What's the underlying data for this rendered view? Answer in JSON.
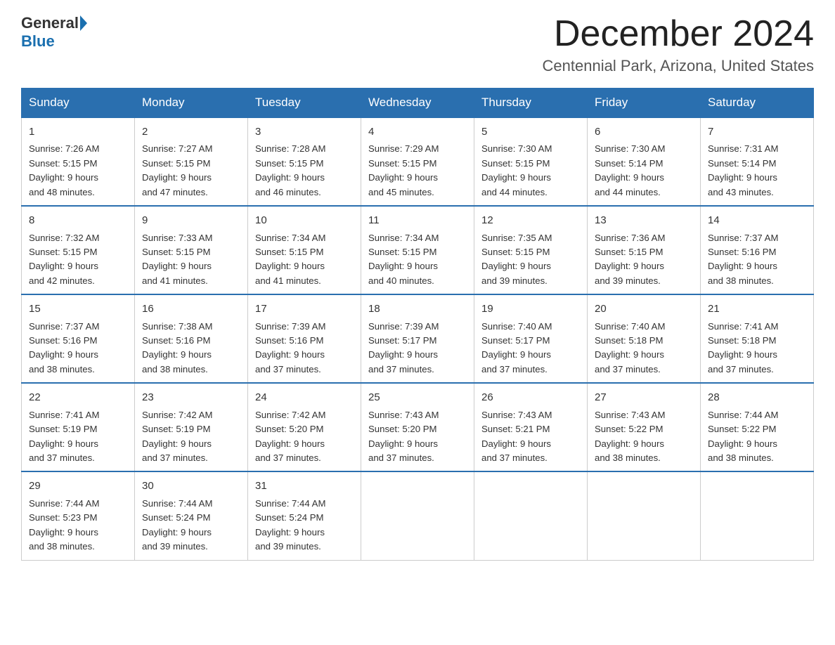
{
  "header": {
    "logo_general": "General",
    "logo_blue": "Blue",
    "month_title": "December 2024",
    "location": "Centennial Park, Arizona, United States"
  },
  "days_of_week": [
    "Sunday",
    "Monday",
    "Tuesday",
    "Wednesday",
    "Thursday",
    "Friday",
    "Saturday"
  ],
  "weeks": [
    [
      {
        "day": "1",
        "sunrise": "7:26 AM",
        "sunset": "5:15 PM",
        "daylight": "9 hours and 48 minutes."
      },
      {
        "day": "2",
        "sunrise": "7:27 AM",
        "sunset": "5:15 PM",
        "daylight": "9 hours and 47 minutes."
      },
      {
        "day": "3",
        "sunrise": "7:28 AM",
        "sunset": "5:15 PM",
        "daylight": "9 hours and 46 minutes."
      },
      {
        "day": "4",
        "sunrise": "7:29 AM",
        "sunset": "5:15 PM",
        "daylight": "9 hours and 45 minutes."
      },
      {
        "day": "5",
        "sunrise": "7:30 AM",
        "sunset": "5:15 PM",
        "daylight": "9 hours and 44 minutes."
      },
      {
        "day": "6",
        "sunrise": "7:30 AM",
        "sunset": "5:14 PM",
        "daylight": "9 hours and 44 minutes."
      },
      {
        "day": "7",
        "sunrise": "7:31 AM",
        "sunset": "5:14 PM",
        "daylight": "9 hours and 43 minutes."
      }
    ],
    [
      {
        "day": "8",
        "sunrise": "7:32 AM",
        "sunset": "5:15 PM",
        "daylight": "9 hours and 42 minutes."
      },
      {
        "day": "9",
        "sunrise": "7:33 AM",
        "sunset": "5:15 PM",
        "daylight": "9 hours and 41 minutes."
      },
      {
        "day": "10",
        "sunrise": "7:34 AM",
        "sunset": "5:15 PM",
        "daylight": "9 hours and 41 minutes."
      },
      {
        "day": "11",
        "sunrise": "7:34 AM",
        "sunset": "5:15 PM",
        "daylight": "9 hours and 40 minutes."
      },
      {
        "day": "12",
        "sunrise": "7:35 AM",
        "sunset": "5:15 PM",
        "daylight": "9 hours and 39 minutes."
      },
      {
        "day": "13",
        "sunrise": "7:36 AM",
        "sunset": "5:15 PM",
        "daylight": "9 hours and 39 minutes."
      },
      {
        "day": "14",
        "sunrise": "7:37 AM",
        "sunset": "5:16 PM",
        "daylight": "9 hours and 38 minutes."
      }
    ],
    [
      {
        "day": "15",
        "sunrise": "7:37 AM",
        "sunset": "5:16 PM",
        "daylight": "9 hours and 38 minutes."
      },
      {
        "day": "16",
        "sunrise": "7:38 AM",
        "sunset": "5:16 PM",
        "daylight": "9 hours and 38 minutes."
      },
      {
        "day": "17",
        "sunrise": "7:39 AM",
        "sunset": "5:16 PM",
        "daylight": "9 hours and 37 minutes."
      },
      {
        "day": "18",
        "sunrise": "7:39 AM",
        "sunset": "5:17 PM",
        "daylight": "9 hours and 37 minutes."
      },
      {
        "day": "19",
        "sunrise": "7:40 AM",
        "sunset": "5:17 PM",
        "daylight": "9 hours and 37 minutes."
      },
      {
        "day": "20",
        "sunrise": "7:40 AM",
        "sunset": "5:18 PM",
        "daylight": "9 hours and 37 minutes."
      },
      {
        "day": "21",
        "sunrise": "7:41 AM",
        "sunset": "5:18 PM",
        "daylight": "9 hours and 37 minutes."
      }
    ],
    [
      {
        "day": "22",
        "sunrise": "7:41 AM",
        "sunset": "5:19 PM",
        "daylight": "9 hours and 37 minutes."
      },
      {
        "day": "23",
        "sunrise": "7:42 AM",
        "sunset": "5:19 PM",
        "daylight": "9 hours and 37 minutes."
      },
      {
        "day": "24",
        "sunrise": "7:42 AM",
        "sunset": "5:20 PM",
        "daylight": "9 hours and 37 minutes."
      },
      {
        "day": "25",
        "sunrise": "7:43 AM",
        "sunset": "5:20 PM",
        "daylight": "9 hours and 37 minutes."
      },
      {
        "day": "26",
        "sunrise": "7:43 AM",
        "sunset": "5:21 PM",
        "daylight": "9 hours and 37 minutes."
      },
      {
        "day": "27",
        "sunrise": "7:43 AM",
        "sunset": "5:22 PM",
        "daylight": "9 hours and 38 minutes."
      },
      {
        "day": "28",
        "sunrise": "7:44 AM",
        "sunset": "5:22 PM",
        "daylight": "9 hours and 38 minutes."
      }
    ],
    [
      {
        "day": "29",
        "sunrise": "7:44 AM",
        "sunset": "5:23 PM",
        "daylight": "9 hours and 38 minutes."
      },
      {
        "day": "30",
        "sunrise": "7:44 AM",
        "sunset": "5:24 PM",
        "daylight": "9 hours and 39 minutes."
      },
      {
        "day": "31",
        "sunrise": "7:44 AM",
        "sunset": "5:24 PM",
        "daylight": "9 hours and 39 minutes."
      },
      null,
      null,
      null,
      null
    ]
  ],
  "labels": {
    "sunrise": "Sunrise:",
    "sunset": "Sunset:",
    "daylight": "Daylight:"
  }
}
